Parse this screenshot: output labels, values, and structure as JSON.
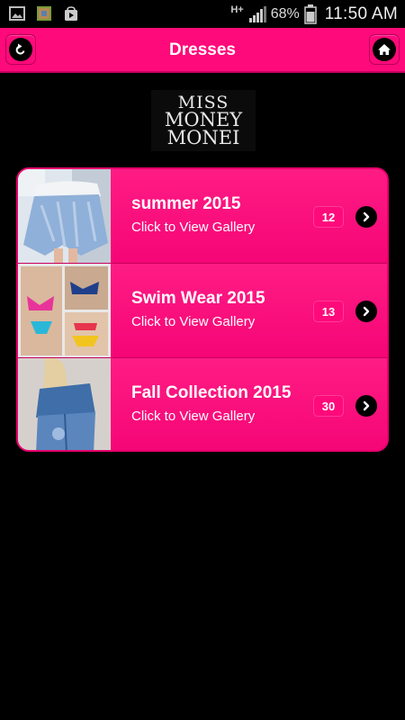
{
  "status_bar": {
    "network": "H+",
    "battery_percent": "68%",
    "time": "11:50 AM",
    "icons": [
      "gallery-icon",
      "photo-icon",
      "play-store-icon",
      "signal-icon",
      "battery-icon"
    ]
  },
  "header": {
    "title": "Dresses",
    "back_icon": "back-arrow-icon",
    "home_icon": "home-icon",
    "accent_color": "#ff0a7a"
  },
  "logo": {
    "line1": "MISS",
    "line2": "MONEY",
    "line3": "MONEI"
  },
  "galleries": [
    {
      "name": "summer 2015",
      "subtitle": "Click to View Gallery",
      "count": "12",
      "thumb": "white-lace-dress-photo"
    },
    {
      "name": "Swim Wear 2015",
      "subtitle": "Click to View Gallery",
      "count": "13",
      "thumb": "bikini-collage-photo"
    },
    {
      "name": "Fall Collection 2015",
      "subtitle": "Click to View Gallery",
      "count": "30",
      "thumb": "denim-outfit-photo"
    }
  ]
}
